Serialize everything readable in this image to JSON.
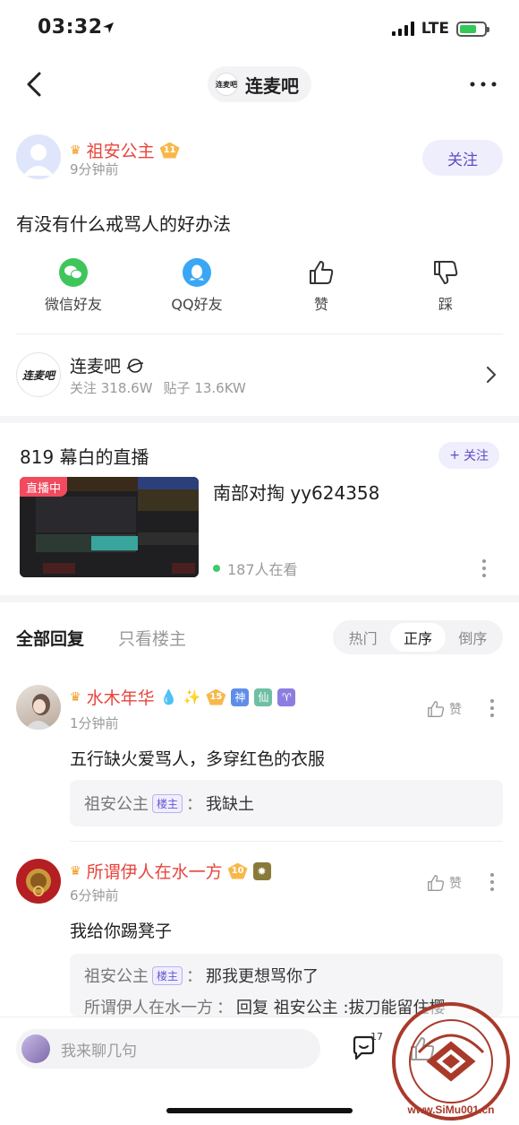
{
  "status": {
    "time": "03:32",
    "network": "LTE"
  },
  "nav": {
    "forum_chip": "连麦吧",
    "chip_logo": "连麦吧"
  },
  "post": {
    "author": "祖安公主",
    "author_level": "11",
    "time": "9分钟前",
    "follow": "关注",
    "title": "有没有什么戒骂人的好办法"
  },
  "actions": [
    {
      "label": "微信好友",
      "icon": "wechat-icon"
    },
    {
      "label": "QQ好友",
      "icon": "qq-icon"
    },
    {
      "label": "赞",
      "icon": "thumbs-up-icon"
    },
    {
      "label": "踩",
      "icon": "thumbs-down-icon"
    }
  ],
  "forum": {
    "logo_text": "连麦吧",
    "name": "连麦吧",
    "followers": "关注 318.6W",
    "posts": "贴子 13.6KW"
  },
  "live": {
    "title": "819 幕白的直播",
    "follow": "关注",
    "tag": "直播中",
    "desc": "南部对掏 yy624358",
    "viewers": "187人在看"
  },
  "reply_tabs": {
    "all": "全部回复",
    "owner_only": "只看楼主"
  },
  "sort": {
    "hot": "热门",
    "asc": "正序",
    "desc": "倒序",
    "active": "正序"
  },
  "comments": [
    {
      "name": "水木年华",
      "level": "15",
      "badges": [
        "神",
        "仙",
        "♈"
      ],
      "time": "1分钟前",
      "like": "赞",
      "text": "五行缺火爱骂人，多穿红色的衣服",
      "replies": [
        {
          "name": "祖安公主",
          "tag": "楼主",
          "sep": "：",
          "text": "我缺土"
        }
      ]
    },
    {
      "name": "所谓伊人在水一方",
      "level": "10",
      "time": "6分钟前",
      "like": "赞",
      "text": "我给你踢凳子",
      "replies": [
        {
          "name": "祖安公主",
          "tag": "楼主",
          "sep": "：",
          "text": "那我更想骂你了"
        },
        {
          "name": "所谓伊人在水一方",
          "sep": "：",
          "text": "回复 祖安公主 :拔刀能留住樱"
        }
      ]
    }
  ],
  "bottom": {
    "placeholder": "我来聊几句",
    "comment_count": "17"
  },
  "watermark": {
    "url": "www.SiMu001.cn"
  }
}
